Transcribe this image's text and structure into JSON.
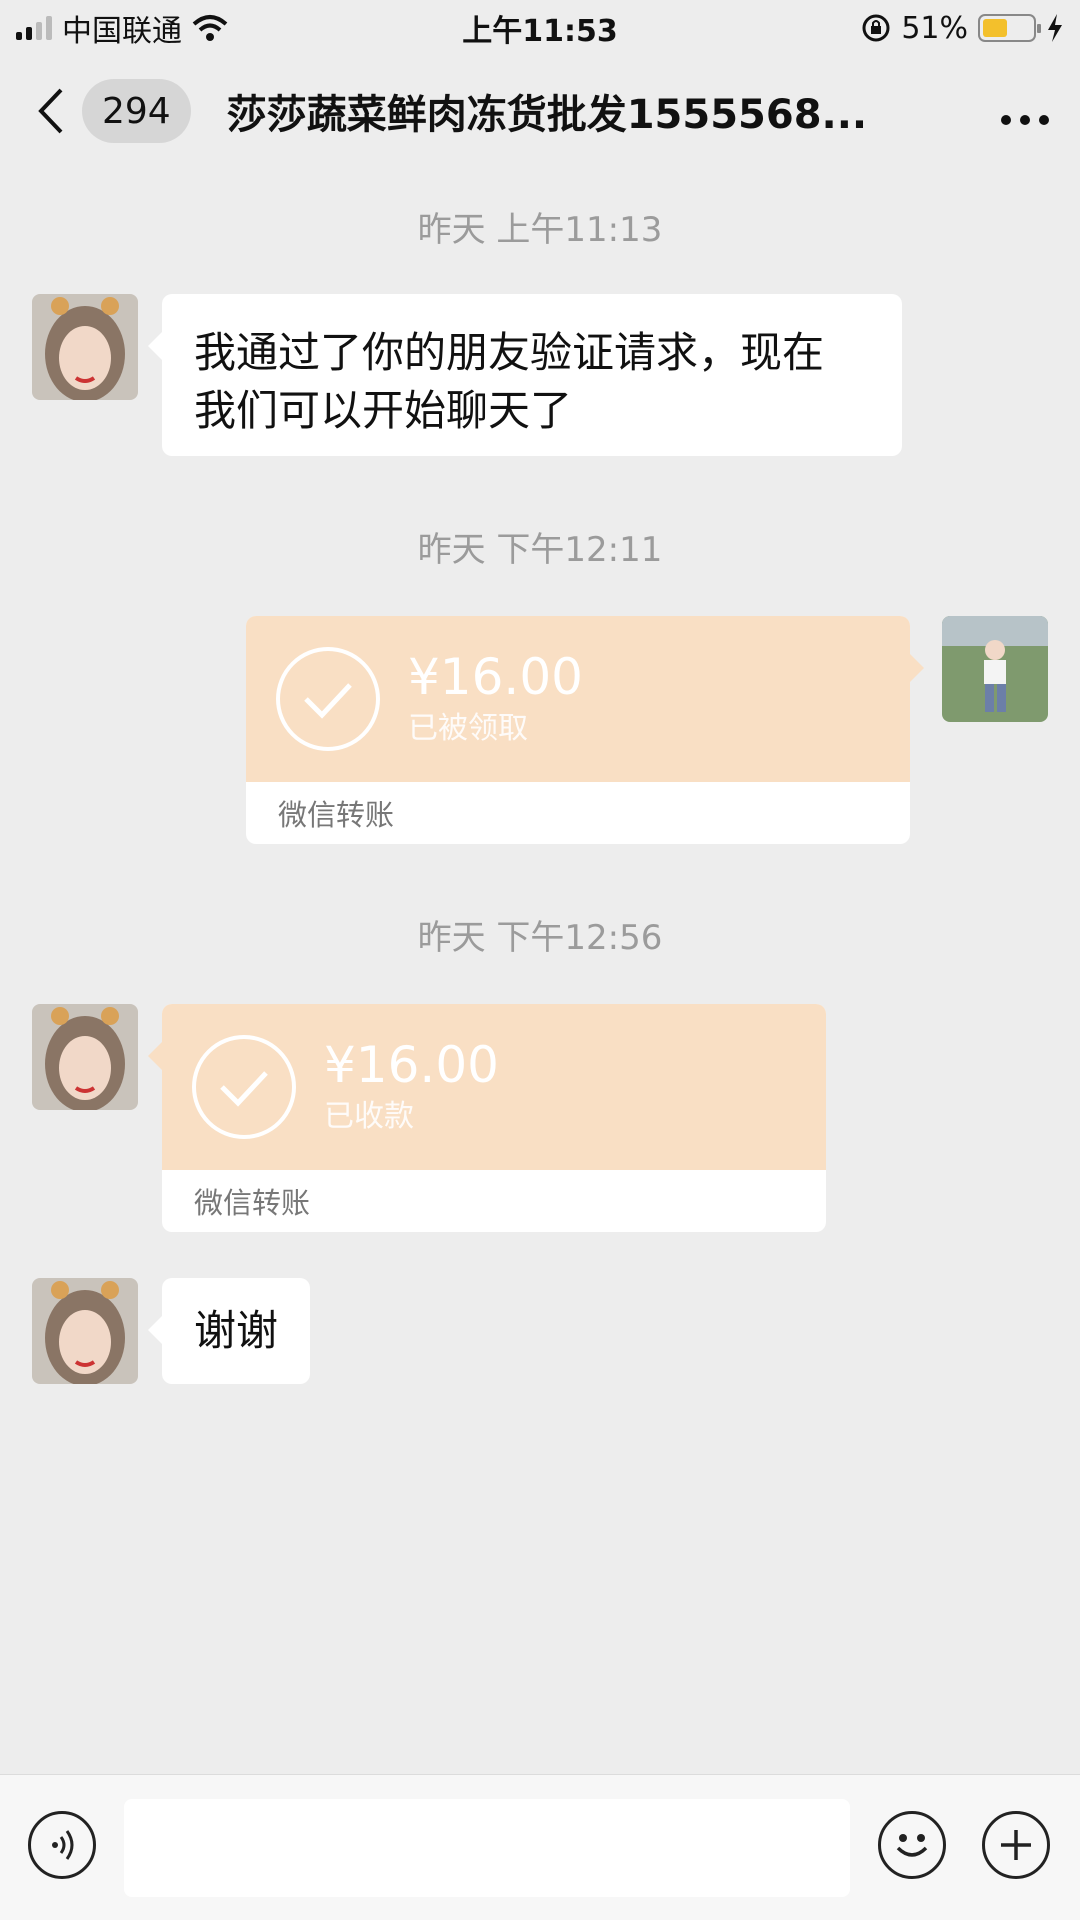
{
  "status_bar": {
    "carrier": "中国联通",
    "time": "上午11:53",
    "battery": "51%",
    "battery_level": 0.51
  },
  "header": {
    "back_count": "294",
    "title": "莎莎蔬菜鲜肉冻货批发1555568..."
  },
  "messages": [
    {
      "type": "time",
      "text": "昨天 上午11:13"
    },
    {
      "type": "text",
      "side": "left",
      "lines": [
        "我通过了你的朋友验证请求，现在",
        "我们可以开始聊天了"
      ]
    },
    {
      "type": "time",
      "text": "昨天 下午12:11"
    },
    {
      "type": "transfer",
      "side": "right",
      "amount": "¥16.00",
      "status": "已被领取",
      "footer": "微信转账"
    },
    {
      "type": "time",
      "text": "昨天 下午12:56"
    },
    {
      "type": "transfer",
      "side": "left",
      "amount": "¥16.00",
      "status": "已收款",
      "footer": "微信转账"
    },
    {
      "type": "text",
      "side": "left",
      "lines": [
        "谢谢"
      ]
    }
  ],
  "input_bar": {
    "placeholder": ""
  },
  "colors": {
    "background": "#ededed",
    "transfer_accent": "#f9dfc4",
    "battery": "#f3c02c"
  }
}
